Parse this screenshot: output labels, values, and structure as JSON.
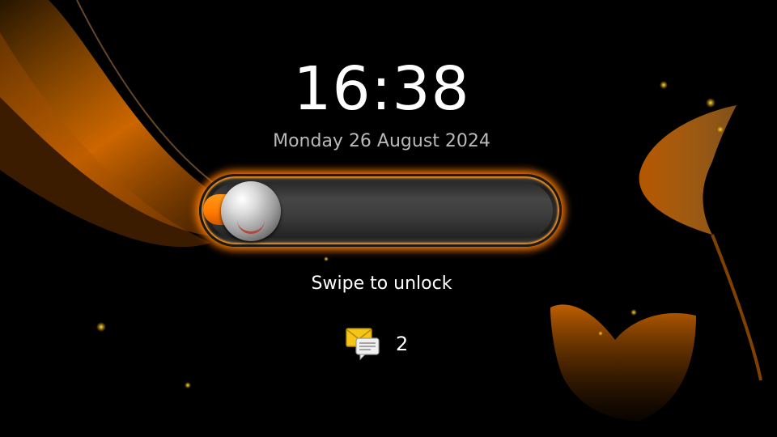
{
  "lockscreen": {
    "time": "16:38",
    "date": "Monday 26 August 2024",
    "unlock_hint": "Swipe to unlock",
    "notifications": {
      "icon": "message-envelope-icon",
      "count": "2"
    }
  },
  "colors": {
    "accent": "#ff7a00",
    "background": "#000000",
    "date_text": "#b9b9b9"
  }
}
